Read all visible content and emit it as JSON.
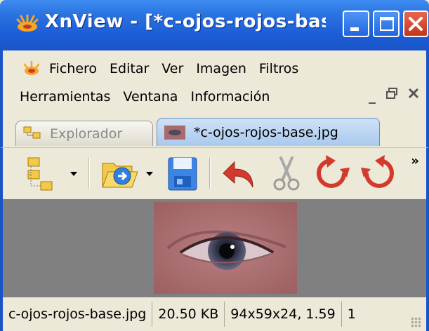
{
  "window": {
    "title": "XnView - [*c-ojos-rojos-bas...",
    "controls": {
      "minimize": "minimize",
      "maximize": "maximize",
      "close": "close"
    }
  },
  "menu": {
    "row1": [
      "Fichero",
      "Editar",
      "Ver",
      "Imagen",
      "Filtros"
    ],
    "row2": [
      "Herramientas",
      "Ventana",
      "Información"
    ]
  },
  "tabs": [
    {
      "label": "Explorador",
      "active": false
    },
    {
      "label": "*c-ojos-rojos-base.jpg",
      "active": true
    }
  ],
  "toolbar": {
    "buttons": [
      "browse-folders-icon",
      "open-file-icon",
      "save-icon",
      "undo-icon",
      "cut-icon",
      "rotate-left-icon",
      "rotate-right-icon"
    ],
    "overflow": "»"
  },
  "status": {
    "filename": "c-ojos-rojos-base.jpg",
    "filesize": "20.50 KB",
    "dimensions": "94x59x24, 1.59",
    "page": "1"
  },
  "colors": {
    "titlebar": "#2a72e0",
    "close_button": "#c2361d",
    "active_tab": "#a9c9ee",
    "viewer_background": "#808080",
    "toolbar_accent": "#d33a2c"
  }
}
